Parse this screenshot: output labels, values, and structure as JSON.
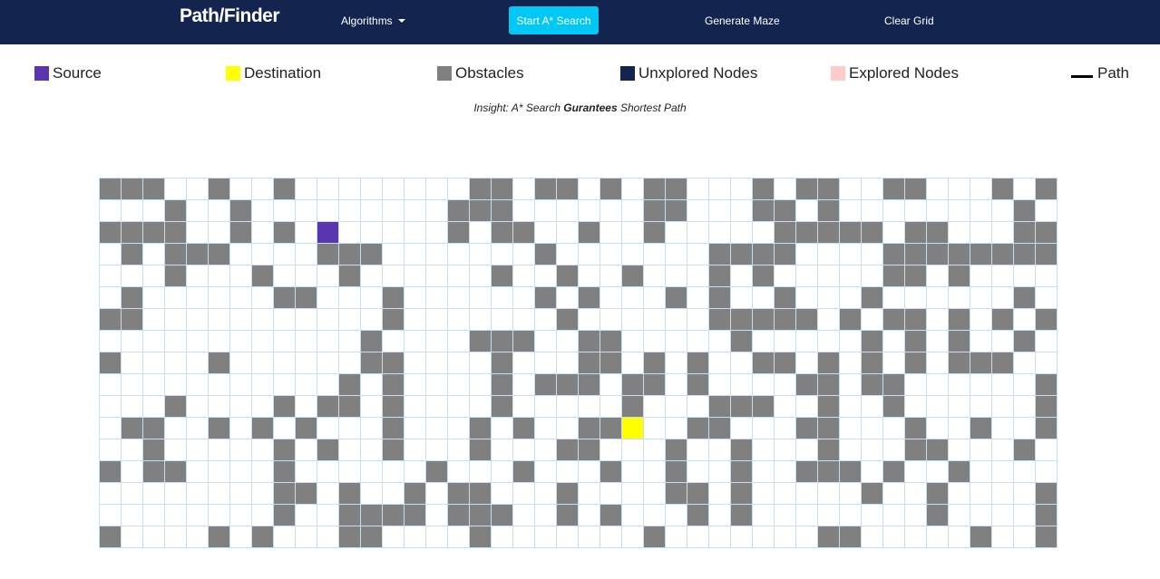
{
  "navbar": {
    "brand": "Path/Finder",
    "algorithms_label": "Algorithms",
    "start_button_label": "Start A* Search",
    "generate_maze_label": "Generate Maze",
    "clear_grid_label": "Clear Grid",
    "background_color": "#13254f",
    "start_button_color": "#00c8f5"
  },
  "legend": {
    "source": {
      "label": "Source",
      "color": "#5a35b0"
    },
    "destination": {
      "label": "Destination",
      "color": "#ffff00"
    },
    "obstacles": {
      "label": "Obstacles",
      "color": "#808080"
    },
    "unexplored": {
      "label": "Unxplored Nodes",
      "color": "#13254f"
    },
    "explored": {
      "label": "Explored Nodes",
      "color": "#ffcccc"
    },
    "path": {
      "label": "Path",
      "color": "#000000"
    }
  },
  "insight": {
    "prefix": "Insight: A* Search",
    "emphasis": "Gurantees",
    "suffix": "Shortest Path"
  },
  "grid": {
    "rows": 17,
    "cols": 44,
    "source": [
      2,
      10
    ],
    "destination": [
      11,
      24
    ],
    "walls": [
      "11100100100000000110110101100010110011000101110",
      "00010010000000001110000001100011010000000010011",
      "11110010100000001011001001000001111101100011000",
      "01011100001110000000100000001111000011111111100",
      "00010001000100000010010010001010000011010000000",
      "01000000110001000000101000101001000100000010010",
      "11000000000001000000010000001111101011010101000",
      "00000000000010000111001100000100000101010010000",
      "10000100000011000010001101010011010101011100010",
      "00000000000101000010111011010000110110000001001",
      "00010000101101000010000010001110010010000001110",
      "01100101010001000101001100011000110001001001000",
      "00100000101001000100011000100100010001100010101",
      "10110000100000010001000100100100111010010000000",
      "00000000110100101100010000110100000100100001000",
      "00000000100111101110010100010100000000100001000",
      "10000101000110000100000001000000011000001001010"
    ]
  }
}
